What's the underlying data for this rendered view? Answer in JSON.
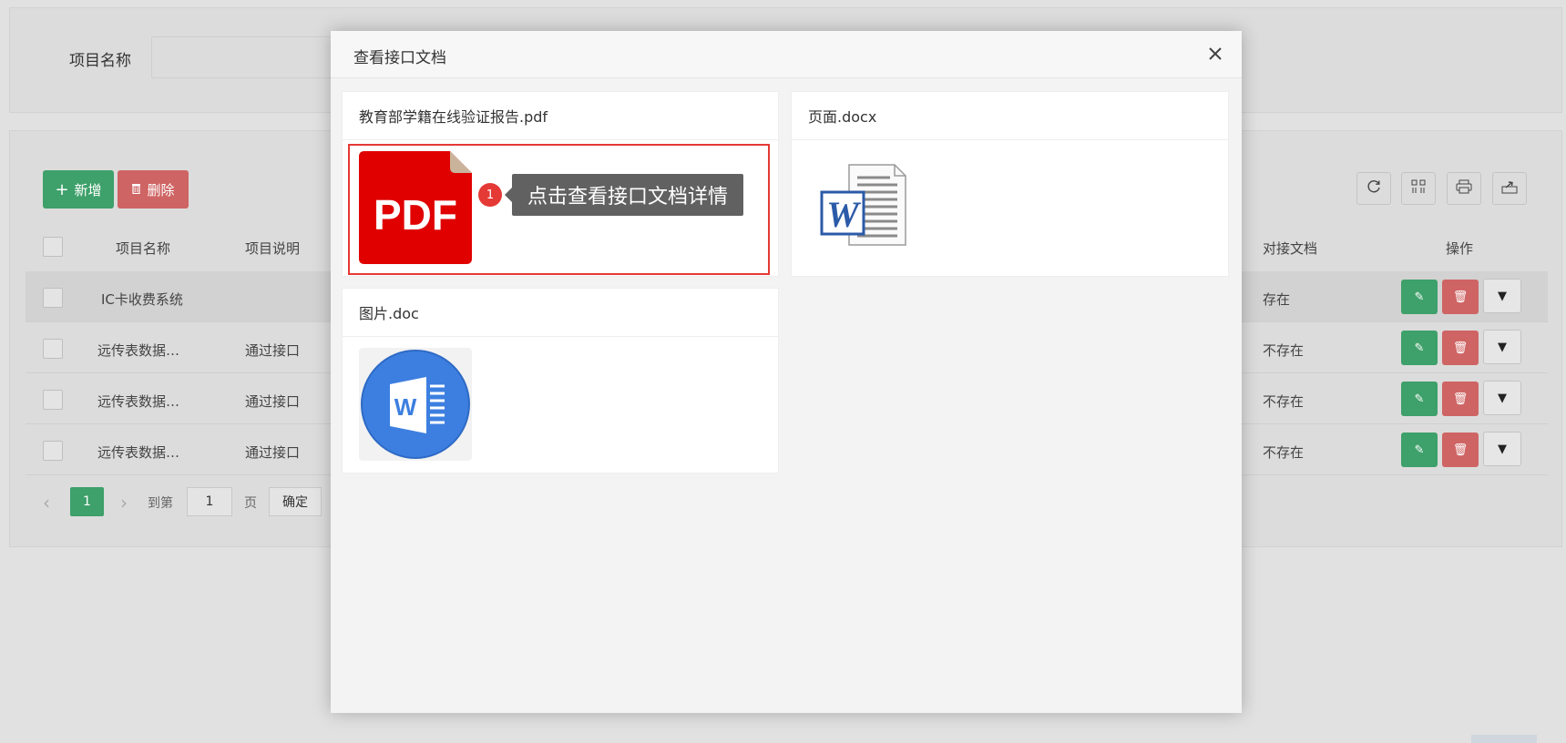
{
  "search": {
    "label": "项目名称"
  },
  "toolbar": {
    "add_label": "新增",
    "delete_label": "删除"
  },
  "table": {
    "headers": {
      "name": "项目名称",
      "desc": "项目说明",
      "doc": "对接文档",
      "ops": "操作"
    },
    "rows": [
      {
        "name": "IC卡收费系统",
        "desc": "",
        "doc": "存在"
      },
      {
        "name": "远传表数据…",
        "desc": "通过接口",
        "doc": "不存在"
      },
      {
        "name": "远传表数据…",
        "desc": "通过接口",
        "doc": "不存在"
      },
      {
        "name": "远传表数据…",
        "desc": "通过接口",
        "doc": "不存在"
      }
    ]
  },
  "pager": {
    "current": "1",
    "goto_label": "到第",
    "goto_value": "1",
    "page_unit": "页",
    "confirm": "确定"
  },
  "modal": {
    "title": "查看接口文档",
    "files": [
      {
        "name": "教育部学籍在线验证报告.pdf",
        "icon": "pdf-file-icon"
      },
      {
        "name": "页面.docx",
        "icon": "word-document-icon"
      },
      {
        "name": "图片.doc",
        "icon": "word-app-icon"
      }
    ],
    "pdf_icon_text": "PDF",
    "word_icon_text": "W",
    "tooltip": {
      "step": "1",
      "text": "点击查看接口文档详情"
    }
  },
  "colors": {
    "green": "#3ea06a",
    "red": "#cf6464",
    "highlight": "#e53935",
    "pdf_red": "#e00000",
    "word_blue": "#3d7fe0"
  }
}
